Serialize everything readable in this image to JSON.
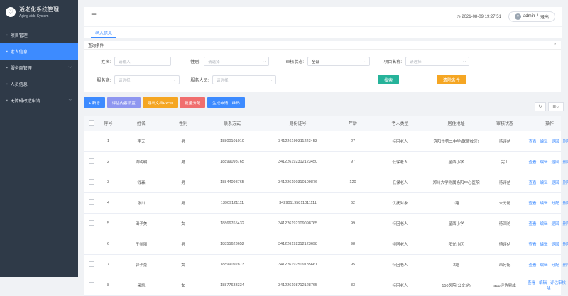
{
  "brand": {
    "title": "适老化系统管理",
    "subtitle": "Aging aids System",
    "logo_icon": "heart-icon"
  },
  "sidebar": {
    "items": [
      {
        "label": "项目管理",
        "active": false,
        "chevron": false
      },
      {
        "label": "老人信息",
        "active": true,
        "chevron": false
      },
      {
        "label": "服务商管理",
        "active": false,
        "chevron": true
      },
      {
        "label": "人员信息",
        "active": false,
        "chevron": false
      },
      {
        "label": "无障碍改造申请",
        "active": false,
        "chevron": true
      }
    ]
  },
  "topbar": {
    "datetime": "2021-08-09 19:27:51",
    "user": "admin",
    "separator": "/",
    "logout": "退出"
  },
  "tabs": [
    {
      "label": "老人信息"
    }
  ],
  "filter": {
    "title": "查询条件",
    "name_label": "姓名:",
    "name_placeholder": "请输入",
    "gender_label": "性别:",
    "gender_placeholder": "请选择",
    "audit_label": "审核状态:",
    "audit_value": "全部",
    "project_label": "项目名称:",
    "project_placeholder": "请选择",
    "provider_label": "服务商:",
    "provider_placeholder": "请选择",
    "staff_label": "服务人员:",
    "staff_placeholder": "请选择",
    "search_button": "搜索",
    "clear_button": "清除条件"
  },
  "toolbar": {
    "add": "+ 新增",
    "assess": "评估内容设置",
    "export": "导出文档Excel",
    "batch": "批量分配",
    "qrcode": "生成申请二维码"
  },
  "colors": {
    "accent": "#3d8bff",
    "sidebar": "#2f3a48",
    "green": "#26b39a",
    "orange": "#f5a623",
    "purple": "#8e96f0",
    "red": "#f06e6e"
  },
  "table": {
    "headers": [
      "序号",
      "姓名",
      "性别",
      "联系方式",
      "身份证号",
      "年龄",
      "老人类型",
      "居住地址",
      "审核状态",
      "操作"
    ],
    "rows": [
      {
        "no": "1",
        "name": "李天",
        "gender": "男",
        "phone": "18800101010",
        "id": "341226199311223453",
        "age": "27",
        "type": "特困老人",
        "address": "洛阳市第二中学(联盟校区)",
        "status": "待评估",
        "ops": [
          "查看",
          "编辑",
          "退回",
          "删除"
        ]
      },
      {
        "no": "2",
        "name": "周明明",
        "gender": "男",
        "phone": "18899098765",
        "id": "341226192312123450",
        "age": "97",
        "type": "低保老人",
        "address": "星西小学",
        "status": "完工",
        "ops": [
          "查看",
          "编辑",
          "退回",
          "删除"
        ]
      },
      {
        "no": "3",
        "name": "钱森",
        "gender": "男",
        "phone": "18844098765",
        "id": "341226190310109876",
        "age": "120",
        "type": "低保老人",
        "address": "郑州大学附属洛阳中心医院",
        "status": "待评估",
        "ops": [
          "查看",
          "编辑",
          "退回",
          "删除"
        ]
      },
      {
        "no": "4",
        "name": "张川",
        "gender": "男",
        "phone": "13909121111",
        "id": "342901195811011111",
        "age": "62",
        "type": "优抚对象",
        "address": "1路",
        "status": "未分配",
        "ops": [
          "查看",
          "编辑",
          "分配",
          "删除"
        ]
      },
      {
        "no": "5",
        "name": "田子美",
        "gender": "女",
        "phone": "18866765432",
        "id": "341226192109098765",
        "age": "99",
        "type": "特困老人",
        "address": "星西小学",
        "status": "待回访",
        "ops": [
          "查看",
          "编辑",
          "退回",
          "删除"
        ]
      },
      {
        "no": "6",
        "name": "王美丽",
        "gender": "男",
        "phone": "18855623652",
        "id": "341226192312123698",
        "age": "98",
        "type": "特困老人",
        "address": "阳光小区",
        "status": "待评估",
        "ops": [
          "查看",
          "编辑",
          "退回",
          "删除"
        ]
      },
      {
        "no": "7",
        "name": "郭子豪",
        "gender": "女",
        "phone": "18899092873",
        "id": "341226192509185661",
        "age": "95",
        "type": "特困老人",
        "address": "2路",
        "status": "未分配",
        "ops": [
          "查看",
          "编辑",
          "分配",
          "删除"
        ]
      },
      {
        "no": "8",
        "name": "采凯",
        "gender": "女",
        "phone": "18877633334",
        "id": "341226198712128765",
        "age": "33",
        "type": "特困老人",
        "address": "150医院(公交站)",
        "status": "app评估完成",
        "ops": [
          "查看",
          "编辑",
          "评估审核",
          "删除"
        ]
      }
    ]
  }
}
